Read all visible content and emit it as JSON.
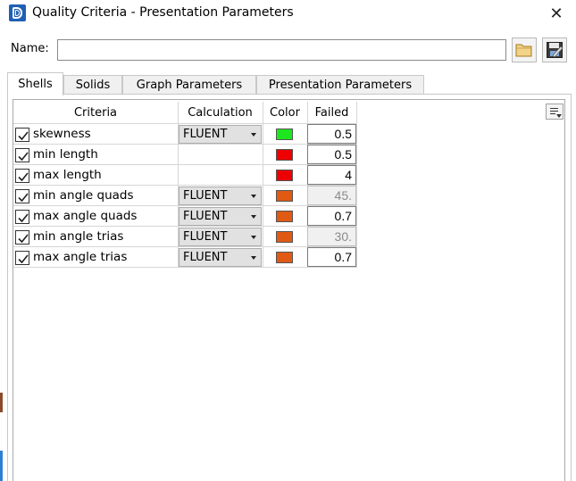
{
  "window": {
    "title": "Quality Criteria - Presentation Parameters",
    "close_glyph": "✕"
  },
  "name_field": {
    "label": "Name:",
    "value": ""
  },
  "tabs": [
    {
      "label": "Shells",
      "active": true
    },
    {
      "label": "Solids",
      "active": false
    },
    {
      "label": "Graph Parameters",
      "active": false
    },
    {
      "label": "Presentation Parameters",
      "active": false
    }
  ],
  "table": {
    "headers": {
      "criteria": "Criteria",
      "calculation": "Calculation",
      "color": "Color",
      "failed": "Failed"
    },
    "rows": [
      {
        "checked": true,
        "criteria": "skewness",
        "calculation": "FLUENT",
        "color": "#1ee61e",
        "failed": "0.5",
        "failed_disabled": false
      },
      {
        "checked": true,
        "criteria": "min length",
        "calculation": "",
        "color": "#ee0000",
        "failed": "0.5",
        "failed_disabled": false
      },
      {
        "checked": true,
        "criteria": "max length",
        "calculation": "",
        "color": "#ee0000",
        "failed": "4",
        "failed_disabled": false
      },
      {
        "checked": true,
        "criteria": "min angle quads",
        "calculation": "FLUENT",
        "color": "#e05a14",
        "failed": "45.",
        "failed_disabled": true
      },
      {
        "checked": true,
        "criteria": "max angle quads",
        "calculation": "FLUENT",
        "color": "#e05a14",
        "failed": "0.7",
        "failed_disabled": false
      },
      {
        "checked": true,
        "criteria": "min angle trias",
        "calculation": "FLUENT",
        "color": "#e05a14",
        "failed": "30.",
        "failed_disabled": true
      },
      {
        "checked": true,
        "criteria": "max angle trias",
        "calculation": "FLUENT",
        "color": "#e05a14",
        "failed": "0.7",
        "failed_disabled": false
      }
    ]
  },
  "icons": {
    "app": "app-logo-icon",
    "open": "folder-open-icon",
    "save": "save-icon",
    "menu": "column-menu-icon"
  }
}
